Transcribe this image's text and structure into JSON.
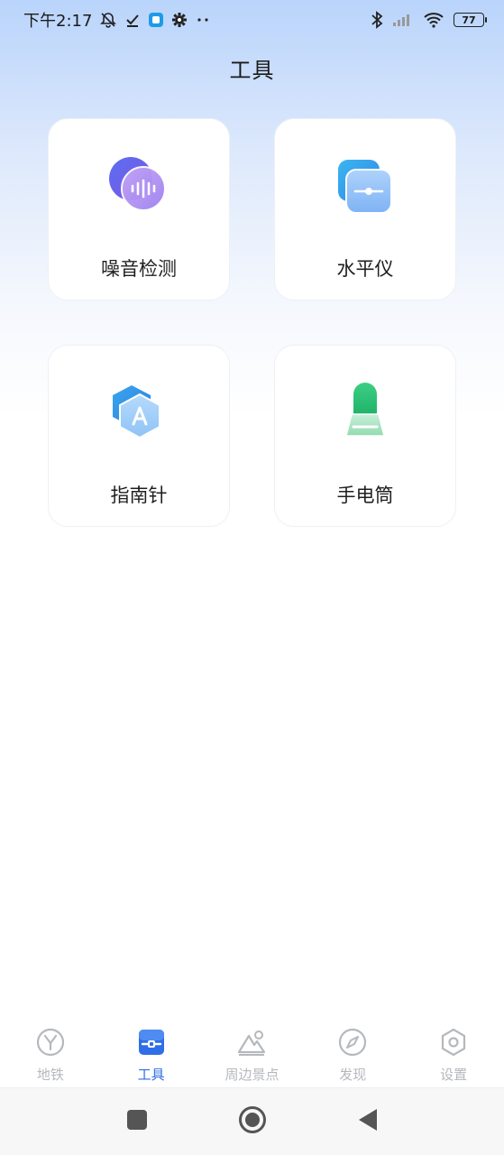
{
  "status_bar": {
    "time": "下午2:17",
    "battery": "77"
  },
  "header": {
    "title": "工具"
  },
  "tools": [
    {
      "label": "噪音检测",
      "icon": "noise-detector-icon"
    },
    {
      "label": "水平仪",
      "icon": "level-icon"
    },
    {
      "label": "指南针",
      "icon": "compass-icon"
    },
    {
      "label": "手电筒",
      "icon": "flashlight-icon"
    }
  ],
  "bottom_nav": {
    "active_index": 1,
    "items": [
      {
        "label": "地铁",
        "icon": "metro-icon"
      },
      {
        "label": "工具",
        "icon": "tools-icon"
      },
      {
        "label": "周边景点",
        "icon": "scenic-spot-icon"
      },
      {
        "label": "发现",
        "icon": "discover-icon"
      },
      {
        "label": "设置",
        "icon": "settings-icon"
      }
    ]
  },
  "colors": {
    "accent": "#2f6ee6",
    "inactive": "#b5b8bd"
  }
}
